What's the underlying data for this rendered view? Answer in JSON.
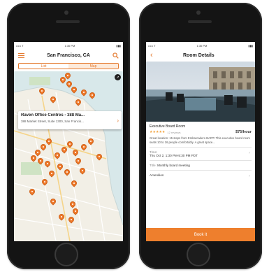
{
  "colors": {
    "accent": "#e47a2f",
    "pin": "#ef7a2b",
    "book_button": "#ee7f2d",
    "map_water": "#d8e8ea",
    "map_land": "#f2efe6"
  },
  "left_phone": {
    "status": {
      "carrier": "••••• T",
      "time": "1:30 PM",
      "battery": "▮▮▮"
    },
    "nav": {
      "title": "San Francisco, CA",
      "menu_icon": "menu-icon",
      "search_icon": "search-icon"
    },
    "segments": [
      "List",
      "Map"
    ],
    "callout": {
      "title": "Raven Office Centres - 388 Ma...",
      "subtitle": "388 Market Street, Suite 1300, San Francis...",
      "arrow": "›"
    },
    "compass_glyph": "↗"
  },
  "right_phone": {
    "status": {
      "carrier": "••••• T",
      "time": "1:30 PM",
      "battery": "▮▮▮"
    },
    "nav": {
      "back_glyph": "‹",
      "title": "Room Details"
    },
    "room": {
      "name": "Executive Board Room",
      "stars": "★★★★★",
      "reviews": "12 reviews",
      "price": "$75/hour",
      "description": "Great location: 15 steps from Embarcadero BART! This executive board room seats 10 to 16 people comfortably. A great space..."
    },
    "rows": [
      {
        "label": "Time:",
        "value": "Thu Oct 2, 1:30 PM-5:30 PM PDT"
      },
      {
        "label": "Title:",
        "value": "Monthly board meeting"
      },
      {
        "label": "Amenities",
        "value": ""
      }
    ],
    "book_label": "Book it"
  }
}
